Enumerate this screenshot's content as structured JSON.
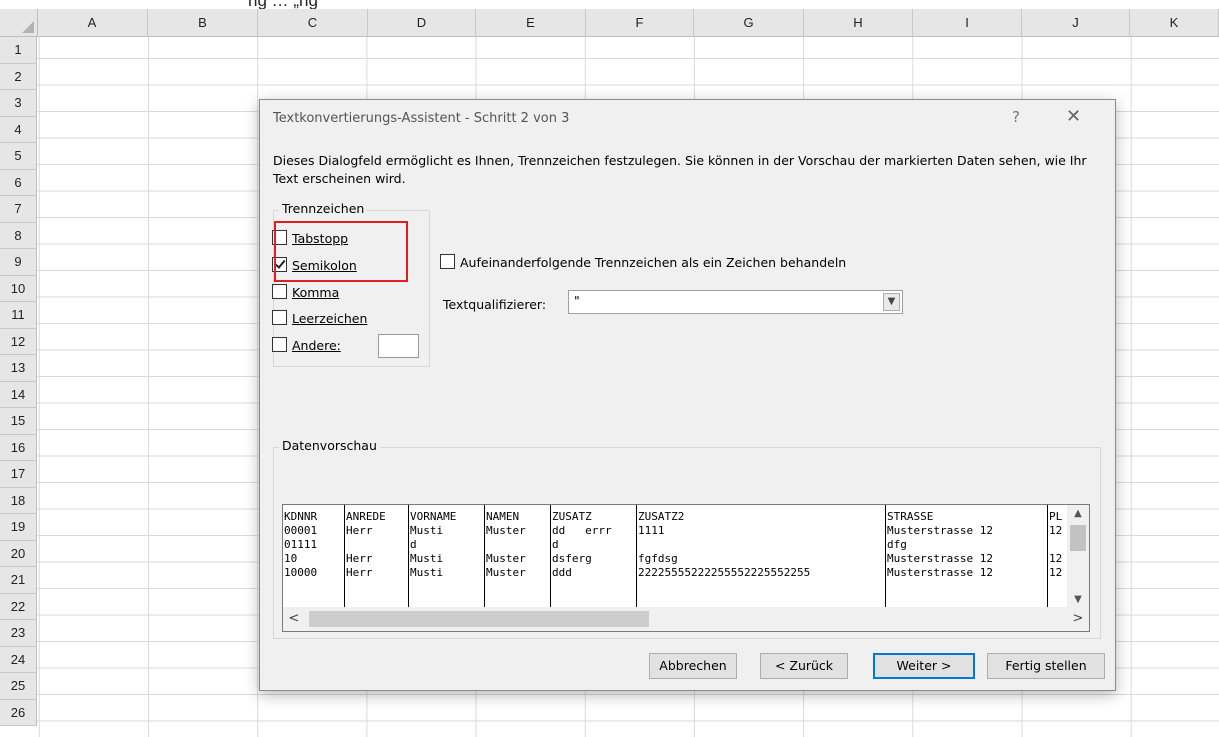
{
  "top_partial_text": "ng … „ng",
  "spreadsheet": {
    "column_headers": [
      "A",
      "B",
      "C",
      "D",
      "E",
      "F",
      "G",
      "H",
      "I",
      "J",
      "K"
    ],
    "row_headers": [
      "1",
      "2",
      "3",
      "4",
      "5",
      "6",
      "7",
      "8",
      "9",
      "10",
      "11",
      "12",
      "13",
      "14",
      "15",
      "16",
      "17",
      "18",
      "19",
      "20",
      "21",
      "22",
      "23",
      "24",
      "25",
      "26"
    ]
  },
  "dialog": {
    "title": "Textkonvertierungs-Assistent - Schritt 2 von 3",
    "help_label": "?",
    "close_label": "✕",
    "description": "Dieses Dialogfeld ermöglicht es Ihnen, Trennzeichen festzulegen. Sie können in der Vorschau der markierten Daten sehen, wie Ihr Text erscheinen wird.",
    "delimiters": {
      "label": "Trennzeichen",
      "items": [
        {
          "label": "Tabstopp",
          "checked": false
        },
        {
          "label": "Semikolon",
          "checked": true
        },
        {
          "label": "Komma",
          "checked": false
        },
        {
          "label": "Leerzeichen",
          "checked": false
        },
        {
          "label": "Andere:",
          "checked": false
        }
      ],
      "other_value": ""
    },
    "consecutive_label": "Aufeinanderfolgende Trennzeichen als ein Zeichen behandeln",
    "consecutive_checked": false,
    "text_qualifier": {
      "label": "Textqualifizierer:",
      "value": "\""
    },
    "preview": {
      "label": "Datenvorschau",
      "columns": [
        {
          "cells": [
            "KDNNR",
            "00001",
            "01111",
            "10",
            "10000"
          ]
        },
        {
          "cells": [
            "ANREDE",
            "Herr",
            "",
            "Herr",
            "Herr"
          ]
        },
        {
          "cells": [
            "VORNAME",
            "Musti",
            "d",
            "Musti",
            "Musti"
          ]
        },
        {
          "cells": [
            "NAMEN",
            "Muster",
            "",
            "Muster",
            "Muster"
          ]
        },
        {
          "cells": [
            "ZUSATZ",
            "dd   errr",
            "d",
            "dsferg",
            "ddd"
          ]
        },
        {
          "cells": [
            "ZUSATZ2",
            "1111",
            "",
            "fgfdsg",
            "22225555222255552225552255"
          ]
        },
        {
          "cells": [
            "STRASSE",
            "Musterstrasse 12",
            "dfg",
            "Musterstrasse 12",
            "Musterstrasse 12"
          ]
        },
        {
          "cells": [
            "PL",
            "12",
            "",
            "12",
            "12"
          ]
        }
      ]
    },
    "buttons": {
      "cancel": "Abbrechen",
      "back": "< Zurück",
      "next": "Weiter >",
      "finish": "Fertig stellen"
    }
  }
}
